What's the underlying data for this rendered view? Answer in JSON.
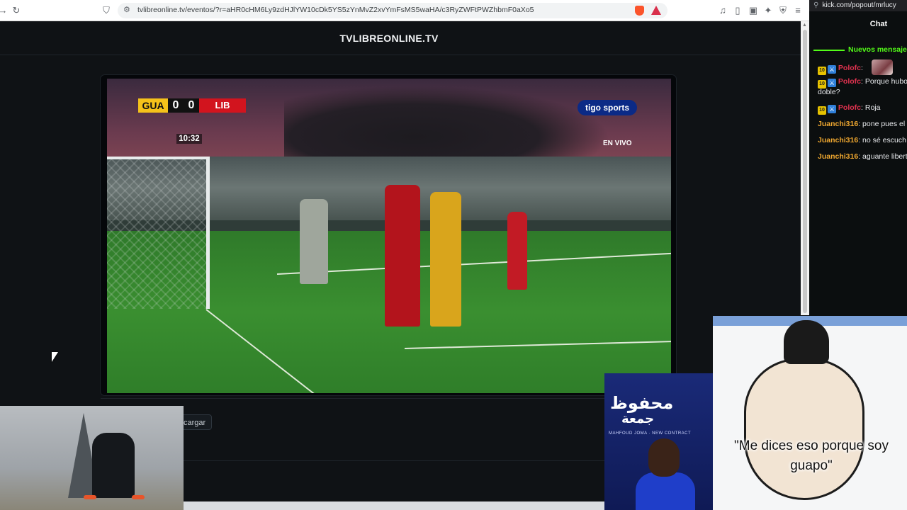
{
  "browser": {
    "url": "tvlibreonline.tv/eventos/?r=aHR0cHM6Ly9zdHJlYW10cDk5YS5zYnMvZ2xvYmFsMS5waHA/c3RyZWFtPWZhbmF0aXo5"
  },
  "page": {
    "site_title": "TVLIBREONLINE.TV",
    "reload_label": "cargar"
  },
  "broadcast": {
    "home_team": "GUA",
    "home_score": "0",
    "away_score": "0",
    "away_team": "LIB",
    "match_clock": "10:32",
    "channel": "tigo sports",
    "live_label": "EN VIVO"
  },
  "chat": {
    "popout_url": "kick.com/popout/mrlucy",
    "title": "Chat",
    "new_messages_label": "Nuevos mensajes",
    "messages": [
      {
        "badge": "10",
        "user": "Polofc",
        "text": ""
      },
      {
        "badge": "10",
        "user": "Polofc",
        "text": "Porque hubo",
        "cont": "doble?"
      },
      {
        "badge": "10",
        "user": "Polofc",
        "text": "Roja"
      },
      {
        "user": "Juanchi316",
        "text": "pone pues el"
      },
      {
        "user": "Juanchi316",
        "text": "no sé escuch"
      },
      {
        "user": "Juanchi316",
        "text": "aguante libert"
      }
    ]
  },
  "overlays": {
    "card_arabic_1": "محفوظ",
    "card_arabic_2": "جمعة",
    "card_subtext": "MAHFOUD JOMA · NEW CONTRACT",
    "meme_caption": "\"Me dices eso porque soy guapo\""
  },
  "colors": {
    "kick_green": "#53fc18",
    "home_team": "#f5c21a",
    "away_team": "#d2141e"
  }
}
